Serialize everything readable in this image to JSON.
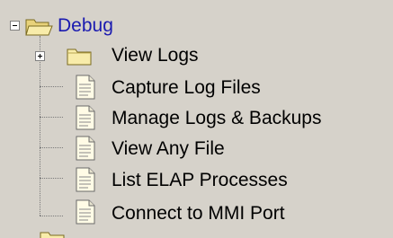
{
  "tree": {
    "root": {
      "label": "Debug",
      "expanded": true,
      "icon": "open-folder-icon"
    },
    "children": [
      {
        "label": "View Logs",
        "type": "folder",
        "expanded": false,
        "icon": "folder-icon"
      },
      {
        "label": "Capture Log Files",
        "type": "document",
        "icon": "document-icon"
      },
      {
        "label": "Manage Logs & Backups",
        "type": "document",
        "icon": "document-icon"
      },
      {
        "label": "View Any File",
        "type": "document",
        "icon": "document-icon"
      },
      {
        "label": "List ELAP Processes",
        "type": "document",
        "icon": "document-icon"
      },
      {
        "label": "Connect to MMI Port",
        "type": "document",
        "icon": "document-icon"
      }
    ]
  },
  "colors": {
    "background": "#d6d2ca",
    "root_label": "#1b1bb0",
    "folder_fill": "#f5e79a",
    "folder_outline": "#8a7a30"
  }
}
